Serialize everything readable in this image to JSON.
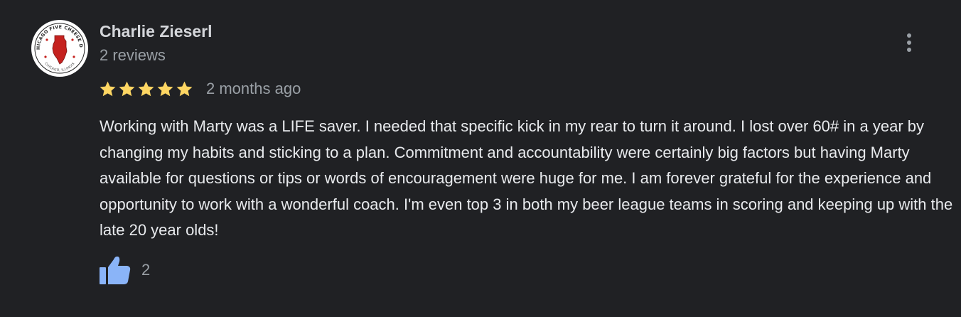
{
  "review": {
    "author": {
      "name": "Charlie Zieserl",
      "review_count": "2 reviews",
      "avatar": {
        "icon": "illinois-state-logo-icon",
        "text_top": "CHICAGO FIVE CHEESE DIP",
        "text_bottom": "CHICAGO, ILLINOIS"
      }
    },
    "rating": 5,
    "max_rating": 5,
    "time_ago": "2 months ago",
    "text": "Working with Marty was a LIFE saver. I needed that specific kick in my rear to turn it around. I lost over 60# in a year by changing my habits and sticking to a plan. Commitment and accountability were certainly big factors but having Marty available for questions or tips or words of encouragement were huge for me. I am forever grateful for the experience and opportunity to work with a wonderful coach. I'm even top 3 in both my beer league teams in scoring and keeping up with the late 20 year olds!",
    "likes": {
      "icon": "thumbs-up-icon",
      "count": "2"
    },
    "menu_icon": "more-vertical-icon"
  },
  "colors": {
    "background": "#202124",
    "star": "#fdd663",
    "thumb": "#8ab4f8",
    "primary_text": "#e8eaed",
    "secondary_text": "#9aa0a6",
    "avatar_red": "#c5221f"
  }
}
